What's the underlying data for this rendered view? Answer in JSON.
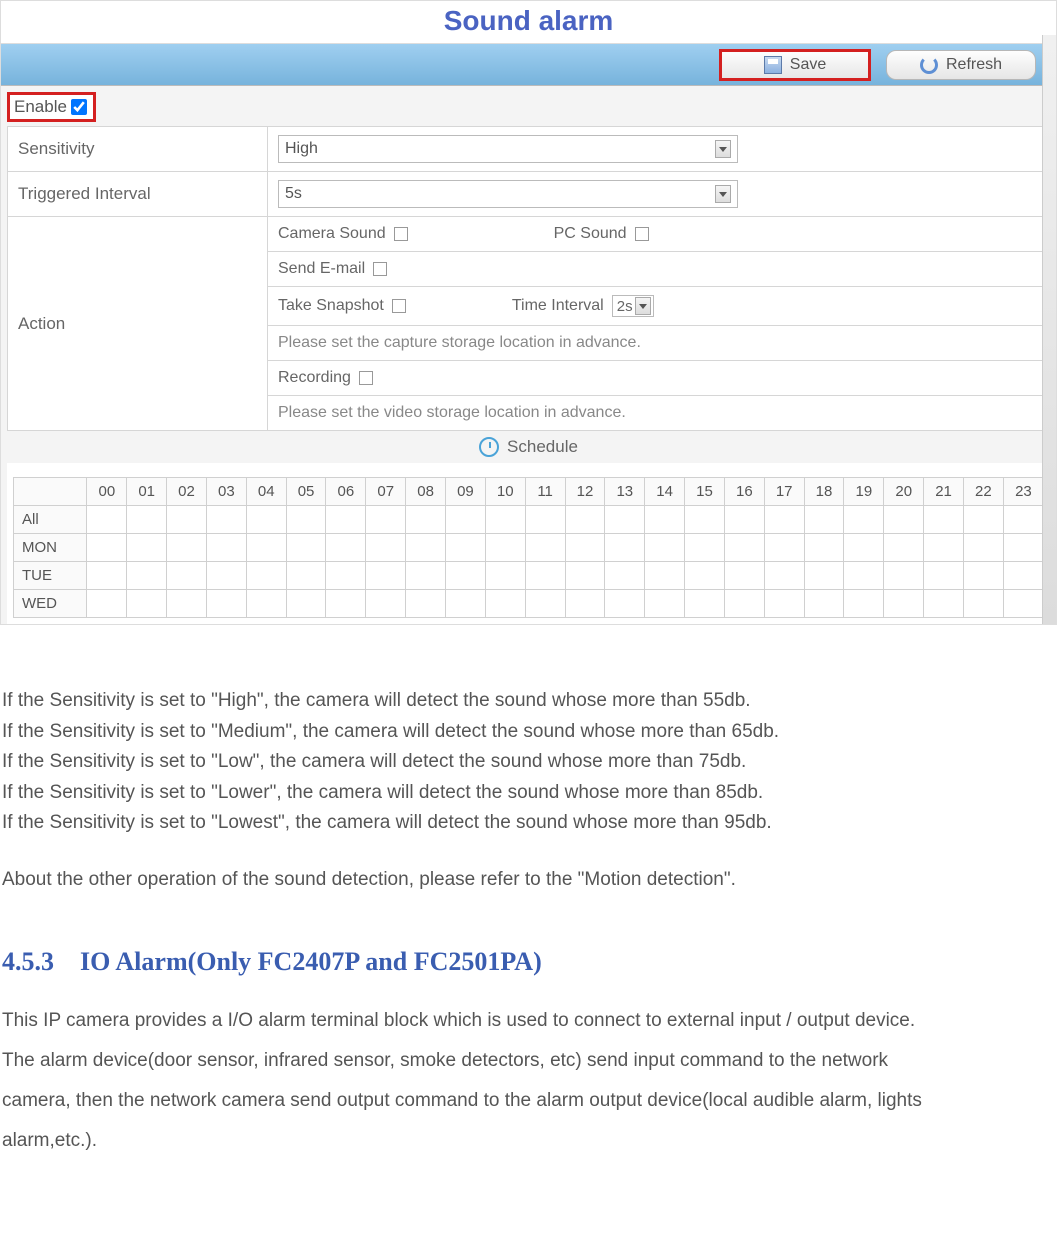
{
  "title": "Sound alarm",
  "toolbar": {
    "save": "Save",
    "refresh": "Refresh"
  },
  "enable_label": "Enable",
  "rows": {
    "sensitivity_label": "Sensitivity",
    "sensitivity_value": "High",
    "interval_label": "Triggered Interval",
    "interval_value": "5s",
    "action_label": "Action"
  },
  "action": {
    "camera_sound": "Camera Sound",
    "pc_sound": "PC Sound",
    "send_email": "Send E-mail",
    "take_snapshot": "Take Snapshot",
    "time_interval_label": "Time Interval",
    "time_interval_value": "2s",
    "snap_note": "Please set the capture storage location in advance.",
    "recording": "Recording",
    "rec_note": "Please set the video storage location in advance."
  },
  "schedule_label": "Schedule",
  "hours": [
    "00",
    "01",
    "02",
    "03",
    "04",
    "05",
    "06",
    "07",
    "08",
    "09",
    "10",
    "11",
    "12",
    "13",
    "14",
    "15",
    "16",
    "17",
    "18",
    "19",
    "20",
    "21",
    "22",
    "23"
  ],
  "days": [
    "All",
    "MON",
    "TUE",
    "WED"
  ],
  "doc": {
    "p1": "If the Sensitivity is set to \"High\", the camera will detect the sound whose more than 55db.",
    "p2": "If the Sensitivity is set to \"Medium\", the camera will detect the sound whose more than 65db.",
    "p3": "If the Sensitivity is set to \"Low\", the camera will detect the sound whose more than 75db.",
    "p4": "If the Sensitivity is set to \"Lower\", the camera will detect the sound whose more than 85db.",
    "p5": "If the Sensitivity is set to \"Lowest\", the camera will detect the sound whose more than 95db.",
    "p6": "About the other operation of the sound detection, please refer to the \"Motion detection\".",
    "heading": "4.5.3 IO Alarm(Only FC2407P and FC2501PA)",
    "b1": "This IP camera provides a I/O alarm terminal block which is used to connect to external input / output device.",
    "b2": "The alarm device(door sensor, infrared sensor, smoke detectors, etc) send input command to the network",
    "b3": "camera, then the network camera send output command to the alarm output device(local audible alarm, lights",
    "b4": "alarm,etc.)."
  }
}
